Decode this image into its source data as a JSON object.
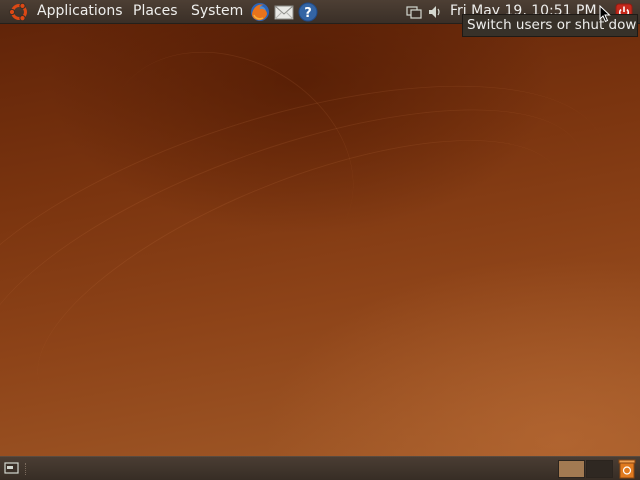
{
  "top_panel": {
    "menus": {
      "applications": "Applications",
      "places": "Places",
      "system": "System"
    },
    "launchers": [
      "firefox-icon",
      "mail-icon",
      "help-icon"
    ],
    "tray": [
      "network-icon",
      "volume-icon"
    ],
    "clock": "Fri May 19, 10:51 PM",
    "session_button": "power-icon"
  },
  "tooltip": {
    "text": "Switch users or shut down"
  },
  "bottom_panel": {
    "show_desktop": "show-desktop-icon",
    "workspaces": 2,
    "active_workspace": 1,
    "trash": "trash-icon"
  },
  "colors": {
    "panel": "#3c3128",
    "desktop": "#7a340f"
  }
}
